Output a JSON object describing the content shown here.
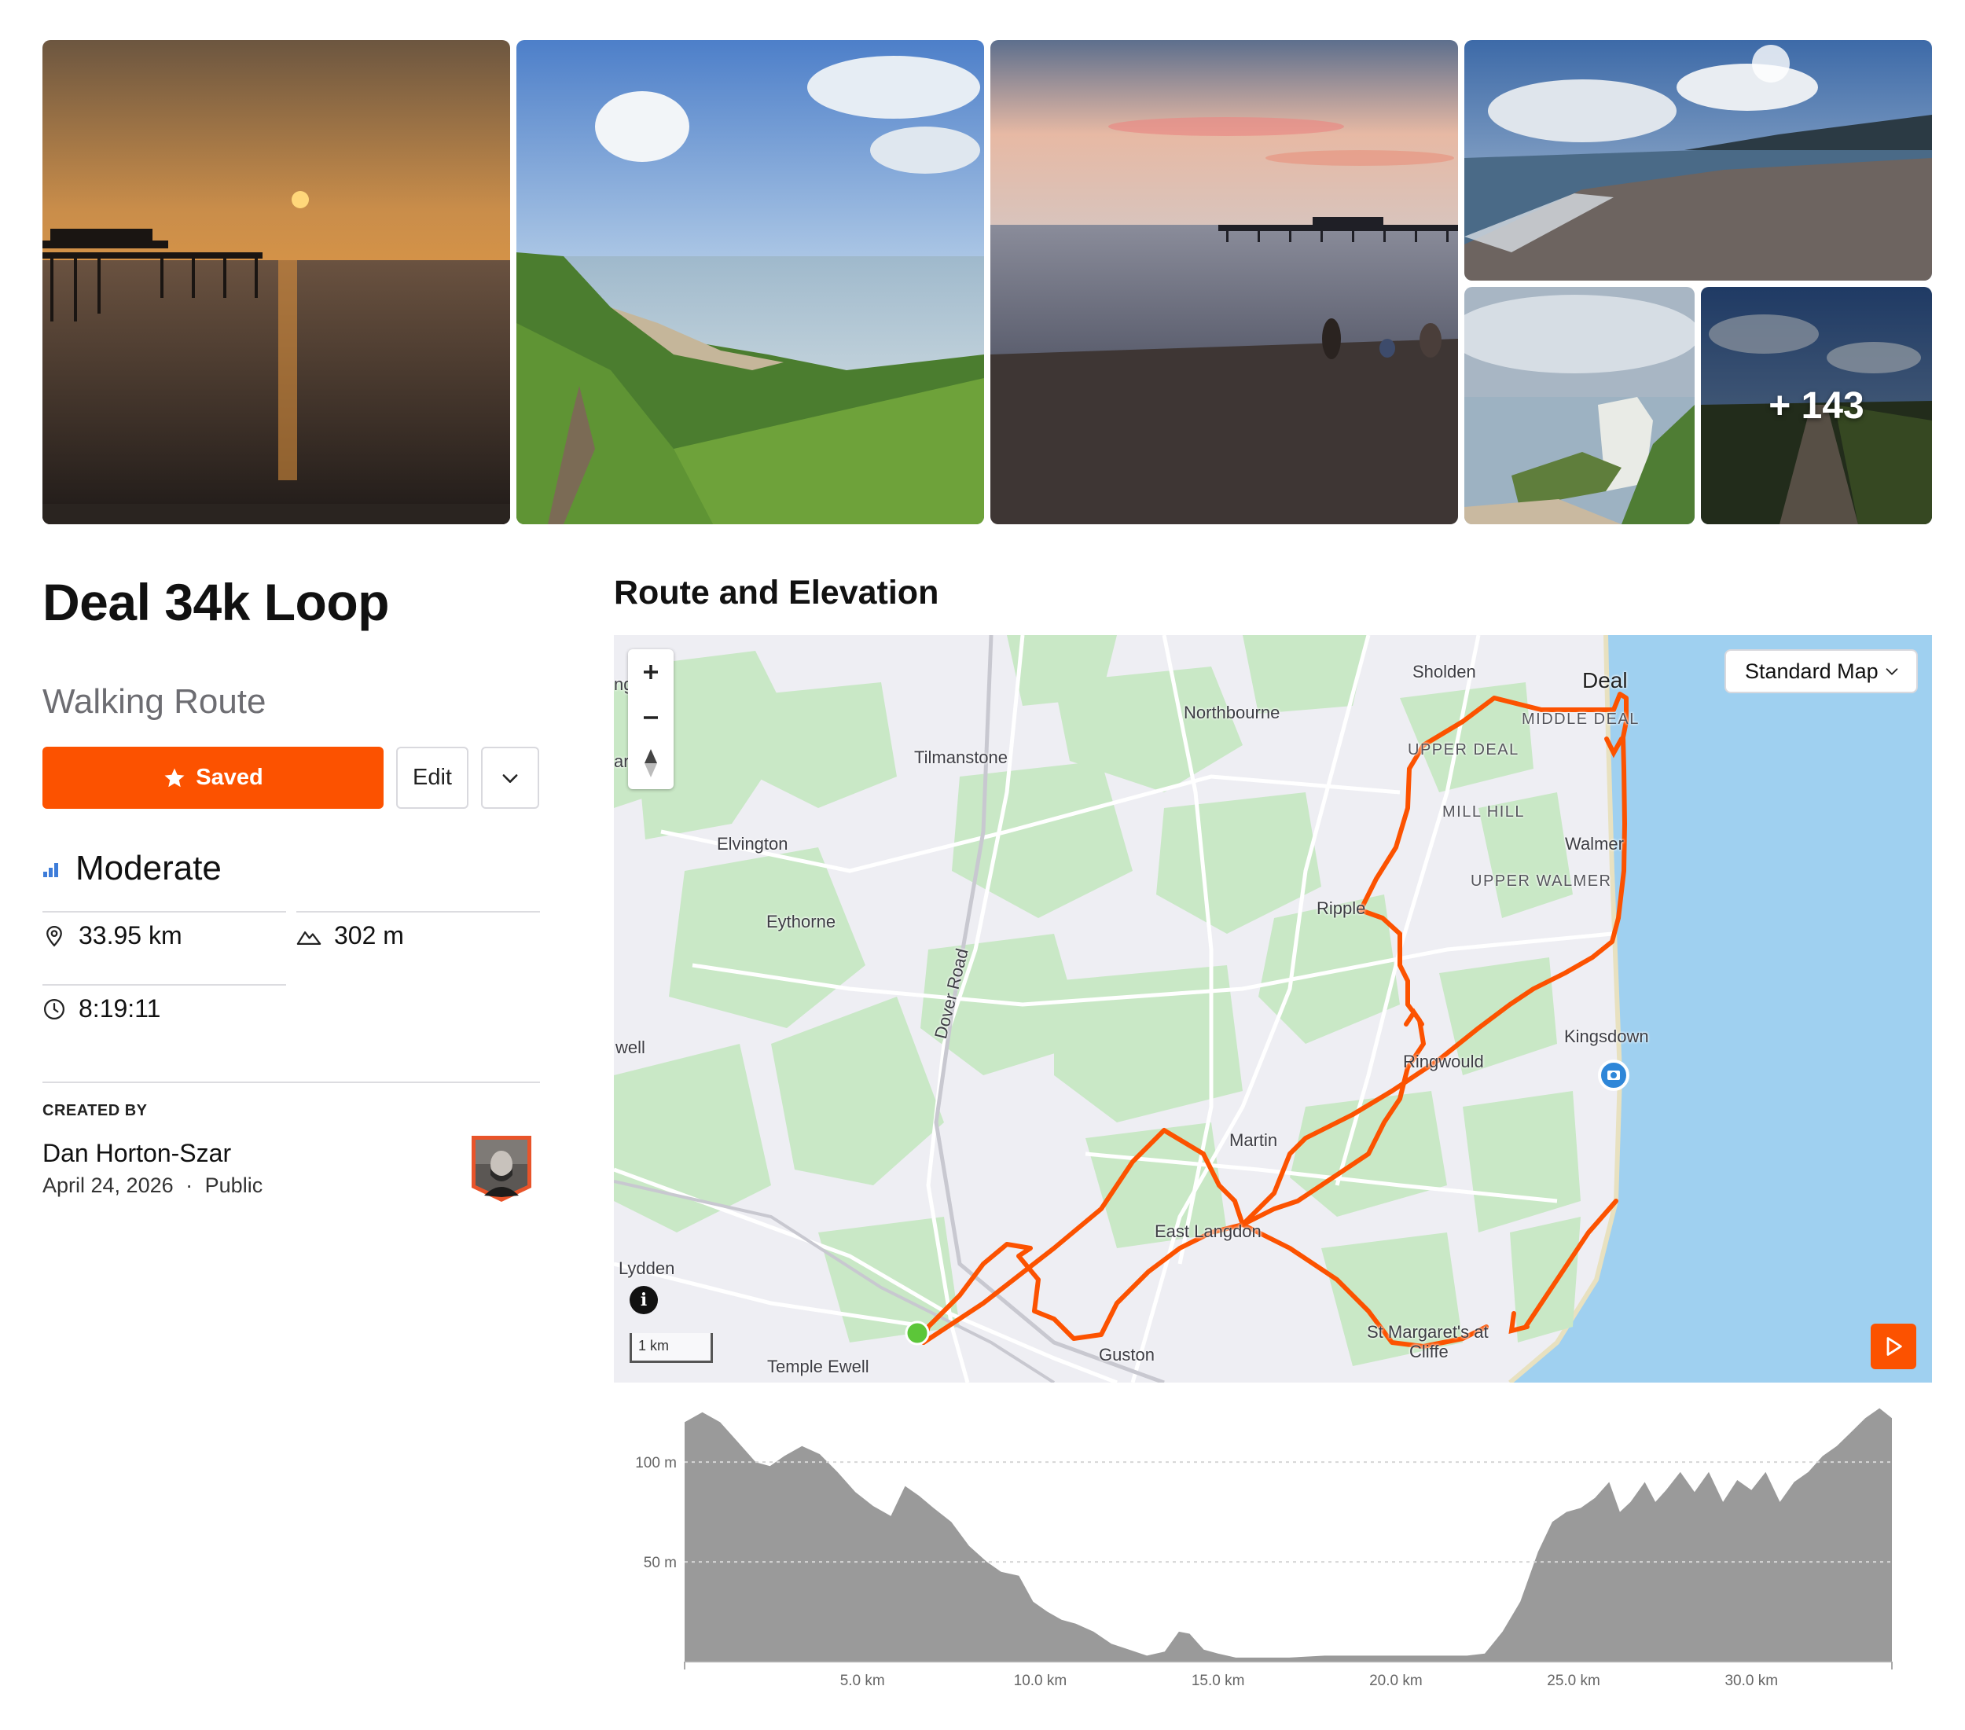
{
  "gallery": {
    "photos": [
      {
        "name": "pier-sunrise-photo"
      },
      {
        "name": "cliff-path-photo"
      },
      {
        "name": "beach-pier-dusk-photo"
      },
      {
        "name": "shingle-beach-photo"
      },
      {
        "name": "white-cliffs-photo"
      },
      {
        "name": "footpath-photo"
      }
    ],
    "more_label": "+ 143"
  },
  "route": {
    "title": "Deal 34k Loop",
    "type": "Walking Route",
    "saved_label": "Saved",
    "edit_label": "Edit",
    "difficulty": "Moderate",
    "stats": {
      "distance": "33.95 km",
      "elevation_gain": "302 m",
      "duration": "8:19:11"
    },
    "created_by_label": "CREATED BY",
    "author": "Dan Horton-Szar",
    "date": "April 24, 2026",
    "separator": "·",
    "visibility": "Public"
  },
  "section": {
    "title": "Route and Elevation"
  },
  "map": {
    "map_type": "Standard Map",
    "scale_label": "1 km",
    "route_color": "#fc5200",
    "labels": {
      "deal": "Deal",
      "sholden": "Sholden",
      "middle_deal": "MIDDLE DEAL",
      "upper_deal": "UPPER DEAL",
      "northbourne": "Northbourne",
      "tilmanstone": "Tilmanstone",
      "mill_hill": "MILL HILL",
      "walmer": "Walmer",
      "upper_walmer": "UPPER WALMER",
      "elvington": "Elvington",
      "eythorne": "Eythorne",
      "ripple": "Ripple",
      "dover_road": "Dover Road",
      "kingsdown": "Kingsdown",
      "ringwould": "Ringwould",
      "well": "well",
      "martin": "Martin",
      "east_langdon": "East Langdon",
      "lydden": "Lydden",
      "st_margarets_1": "St Margaret's at",
      "st_margarets_2": "Cliffe",
      "guston": "Guston",
      "temple_ewell": "Temple Ewell",
      "edge_ng": "ng",
      "edge_ar": "ar"
    }
  },
  "chart_data": {
    "type": "area",
    "ylabel": "",
    "xlabel": "",
    "y_ticks": [
      "100 m",
      "50 m"
    ],
    "y_tick_values": [
      100,
      50
    ],
    "x_ticks": [
      "5.0 km",
      "10.0 km",
      "15.0 km",
      "20.0 km",
      "25.0 km",
      "30.0 km"
    ],
    "x_tick_values": [
      5,
      10,
      15,
      20,
      25,
      30
    ],
    "xlim": [
      0,
      33.95
    ],
    "ylim": [
      0,
      130
    ],
    "grid": true,
    "series": [
      {
        "x": [
          0,
          0.5,
          1.0,
          1.5,
          2.0,
          2.4,
          2.8,
          3.3,
          3.8,
          4.3,
          4.8,
          5.3,
          5.8,
          6.2,
          6.6,
          7.0,
          7.5,
          8.0,
          8.5,
          8.9,
          9.4,
          9.8,
          10.2,
          10.6,
          11.0,
          11.5,
          12.0,
          12.5,
          13.0,
          13.5,
          13.9,
          14.2,
          14.6,
          15.0,
          15.5,
          16.0,
          17.0,
          18.0,
          19.0,
          20.0,
          21.0,
          21.5,
          22.0,
          22.5,
          23.0,
          23.5,
          24.0,
          24.4,
          24.8,
          25.2,
          25.6,
          26.0,
          26.3,
          26.6,
          27.0,
          27.3,
          27.6,
          28.0,
          28.4,
          28.8,
          29.2,
          29.6,
          30.0,
          30.4,
          30.8,
          31.2,
          31.6,
          32.0,
          32.4,
          32.8,
          33.2,
          33.6,
          33.95
        ],
        "y": [
          120,
          125,
          120,
          110,
          100,
          98,
          103,
          108,
          104,
          95,
          85,
          78,
          73,
          88,
          83,
          77,
          70,
          58,
          50,
          45,
          43,
          30,
          25,
          21,
          19,
          15,
          9,
          6,
          3,
          5,
          15,
          14,
          6,
          4,
          2,
          2,
          2,
          3,
          3,
          3,
          3,
          3,
          3,
          4,
          15,
          30,
          55,
          70,
          75,
          77,
          82,
          90,
          75,
          80,
          90,
          80,
          86,
          95,
          85,
          95,
          80,
          91,
          86,
          95,
          80,
          90,
          95,
          103,
          108,
          115,
          122,
          127,
          122
        ]
      }
    ]
  }
}
